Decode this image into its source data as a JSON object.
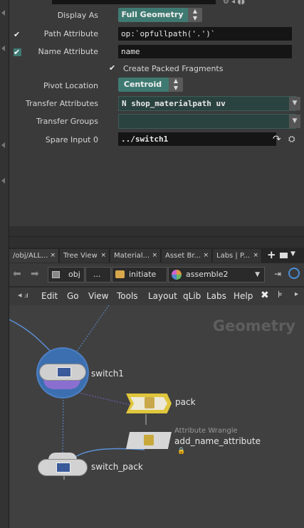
{
  "params": {
    "top_partial": "~",
    "display_as": {
      "label": "Display As",
      "value": "Full Geometry"
    },
    "path_attribute": {
      "label": "Path Attribute",
      "value": "op:`opfullpath('.')`"
    },
    "name_attribute": {
      "label": "Name Attribute",
      "value": "name"
    },
    "create_packed": {
      "label": "Create Packed Fragments",
      "checked": true
    },
    "pivot_location": {
      "label": "Pivot Location",
      "value": "Centroid"
    },
    "transfer_attributes": {
      "label": "Transfer Attributes",
      "value": "N shop_materialpath uv"
    },
    "transfer_groups": {
      "label": "Transfer Groups",
      "value": ""
    },
    "spare_input": {
      "label": "Spare Input 0",
      "value": "../switch1"
    }
  },
  "tabs": [
    {
      "label": "/obj/ALL...",
      "active": true
    },
    {
      "label": "Tree View",
      "active": false
    },
    {
      "label": "Material...",
      "active": false
    },
    {
      "label": "Asset Br...",
      "active": false
    },
    {
      "label": "Labs | P...",
      "active": false
    }
  ],
  "tab_close": "×",
  "pathbar": {
    "crumbs": [
      "obj",
      "...",
      "initiate",
      "assemble2"
    ]
  },
  "menubar": {
    "items": [
      "Edit",
      "Go",
      "View",
      "Tools",
      "Layout",
      "qLib",
      "Labs",
      "Help"
    ]
  },
  "network": {
    "context_title": "Geometry",
    "nodes": {
      "switch1": "switch1",
      "pack": "pack",
      "wrangle_type": "Attribute Wrangle",
      "wrangle": "add_name_attribute",
      "switch_pack": "switch_pack"
    }
  },
  "colors": {
    "accent_teal": "#3f7a72",
    "pack_node": "#e0c63c",
    "switch_ring": "#4d7fc2",
    "network_bg": "#404040"
  }
}
